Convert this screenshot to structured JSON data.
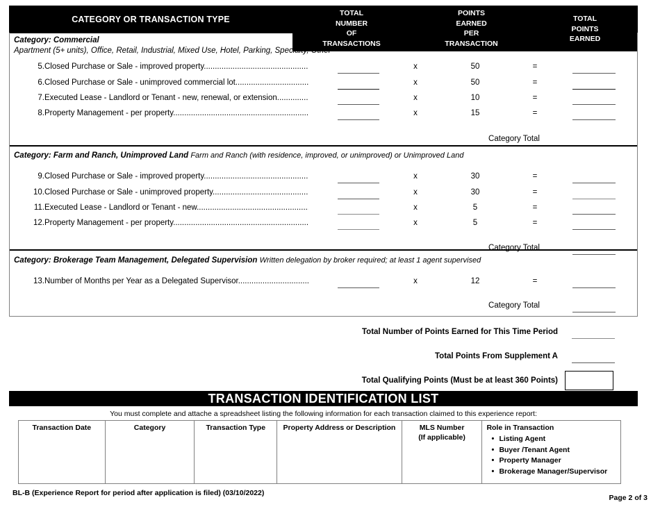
{
  "header": {
    "col_category": "CATEGORY OR TRANSACTION TYPE",
    "col_total_number": [
      "TOTAL",
      "NUMBER",
      "OF",
      "TRANSACTIONS"
    ],
    "col_points_per": [
      "POINTS",
      "EARNED",
      "PER",
      "TRANSACTION"
    ],
    "col_total_points": [
      "TOTAL",
      "POINTS",
      "EARNED"
    ]
  },
  "sections": [
    {
      "category_label": "Category: Commercial",
      "description": "Apartment (5+ units), Office, Retail, Industrial, Mixed Use, Hotel, Parking, Specialty, Other",
      "description_inline": "",
      "rows": [
        {
          "num": "5.",
          "text": "Closed Purchase or Sale - improved property",
          "dots": "................................................................",
          "multiplier": "x",
          "points": "50",
          "equals": "="
        },
        {
          "num": "6.",
          "text": "Closed Purchase or Sale - unimproved commercial lot",
          "dots": ".........................................",
          "multiplier": "x",
          "points": "50",
          "equals": "="
        },
        {
          "num": "7.",
          "text": "Executed Lease - Landlord or Tenant - new, renewal, or extension",
          "dots": "........................",
          "multiplier": "x",
          "points": "10",
          "equals": "="
        },
        {
          "num": "8.",
          "text": "Property Management - per property",
          "dots": "..............................................................",
          "multiplier": "x",
          "points": "15",
          "equals": "="
        }
      ],
      "category_total_label": "Category Total"
    },
    {
      "category_label": "Category: Farm and Ranch, Unimproved Land",
      "description": "",
      "description_inline": "Farm and Ranch (with residence, improved, or unimproved) or Unimproved Land",
      "rows": [
        {
          "num": "9.",
          "text": "Closed Purchase or Sale - improved property",
          "dots": "................................................................",
          "multiplier": "x",
          "points": "30",
          "equals": "="
        },
        {
          "num": "10.",
          "text": "Closed Purchase or Sale - unimproved property",
          "dots": "..........................................................",
          "multiplier": "x",
          "points": "30",
          "equals": "="
        },
        {
          "num": "11.",
          "text": "Executed Lease - Landlord or Tenant - new",
          "dots": "....................................................................",
          "multiplier": "x",
          "points": "5",
          "equals": "="
        },
        {
          "num": "12.",
          "text": "Property Management - per property",
          "dots": "...............................................................",
          "multiplier": "x",
          "points": "5",
          "equals": "="
        }
      ],
      "category_total_label": "Category Total"
    },
    {
      "category_label": "Category: Brokerage Team Management, Delegated Supervision",
      "description": "",
      "description_inline": "Written delegation by broker required; at least 1 agent supervised",
      "rows": [
        {
          "num": "13.",
          "text": "Number of Months per Year as a Delegated Supervisor",
          "dots": "......................................",
          "multiplier": "x",
          "points": "12",
          "equals": "="
        }
      ],
      "category_total_label": "Category Total"
    }
  ],
  "grand_totals": [
    {
      "label": "Total Number of Points Earned for This Time Period",
      "field": "line"
    },
    {
      "label": "Total Points From Supplement A",
      "field": "line"
    },
    {
      "label": "Total Qualifying Points (Must be at least 360 Points)",
      "field": "box"
    }
  ],
  "transaction_list": {
    "title": "TRANSACTION IDENTIFICATION LIST",
    "note": "You must complete and attache a spreadsheet listing the following information for each transaction claimed to this experience report:",
    "columns": [
      {
        "header": "Transaction Date"
      },
      {
        "header": "Category"
      },
      {
        "header": "Transaction Type"
      },
      {
        "header": "Property Address or Description"
      },
      {
        "header": "MLS Number",
        "header2": "(If applicable)"
      },
      {
        "header": "Role in Transaction"
      }
    ],
    "roles": [
      "Listing Agent",
      "Buyer /Tenant Agent",
      "Property Manager",
      "Brokerage Manager/Supervisor"
    ]
  },
  "footer": {
    "left": "BL-B (Experience Report for period after application is filed) (03/10/2022)",
    "right": "Page 2 of 3"
  }
}
